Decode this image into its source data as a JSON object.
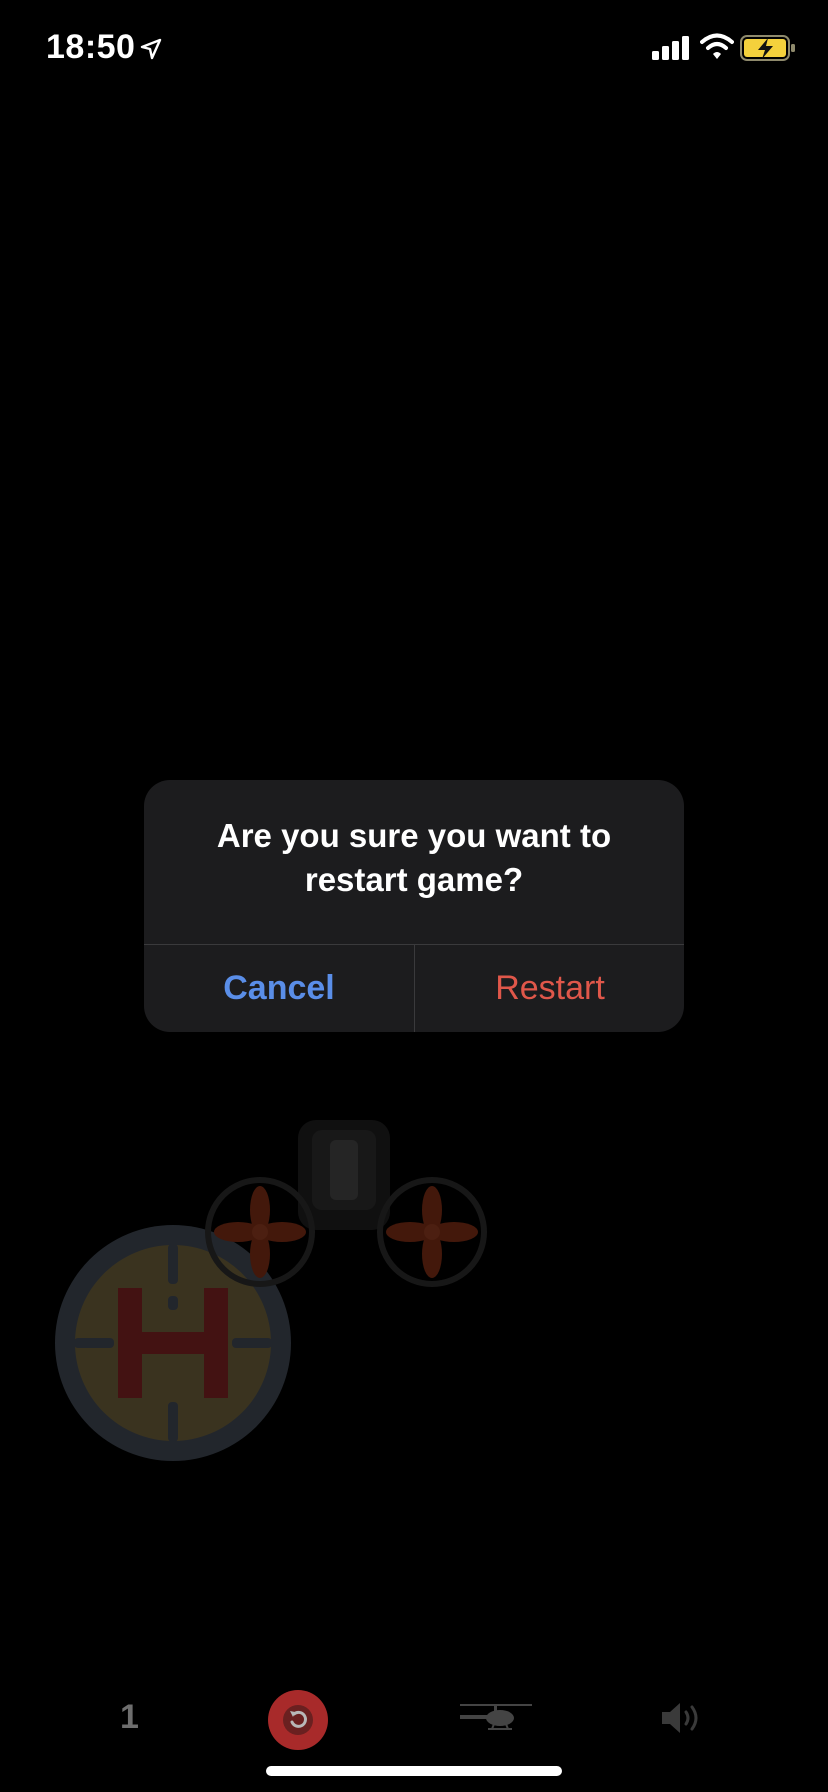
{
  "status_bar": {
    "time": "18:50",
    "icons": [
      "location-arrow-icon",
      "cellular-signal-icon",
      "wifi-icon",
      "battery-charging-icon"
    ],
    "battery_color": "#f4d13c"
  },
  "alert": {
    "message": "Are you sure you want to restart game?",
    "cancel_label": "Cancel",
    "restart_label": "Restart",
    "cancel_color": "#5a8ee8",
    "restart_color": "#e0574a"
  },
  "game": {
    "helipad_letter": "H",
    "helipad_ring_color": "#3e4651",
    "helipad_fill_color": "#6b5e3a",
    "helipad_letter_color": "#7a2222"
  },
  "bottom_bar": {
    "level": "1",
    "icons": [
      "restart-icon",
      "helicopter-icon",
      "speaker-icon"
    ],
    "restart_button_color": "#a82a2a"
  }
}
